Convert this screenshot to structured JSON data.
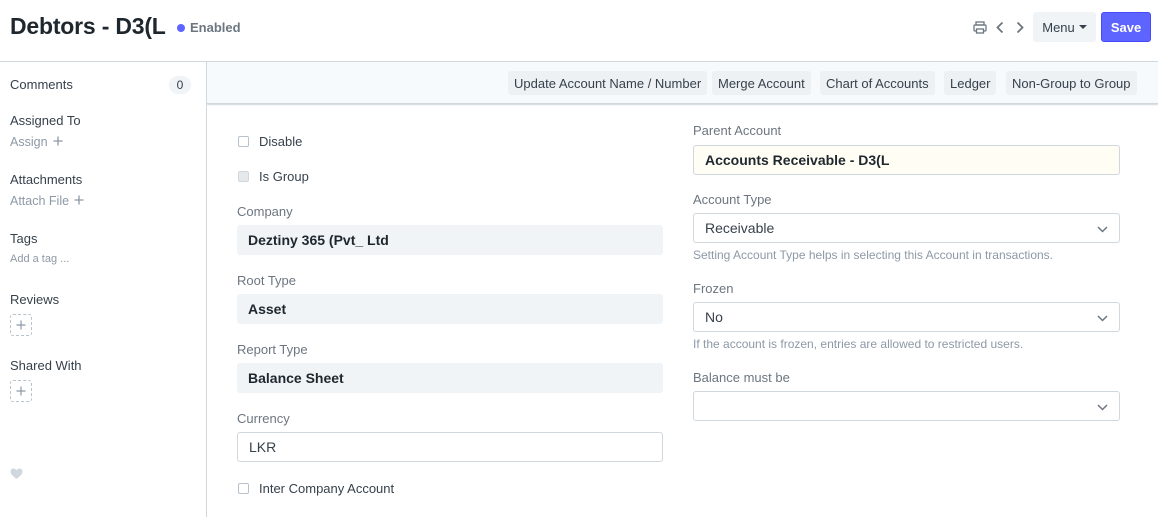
{
  "header": {
    "title": "Debtors - D3(L",
    "status": "Enabled",
    "menu_label": "Menu",
    "save_label": "Save"
  },
  "sidebar": {
    "comments_label": "Comments",
    "comments_count": "0",
    "assigned_label": "Assigned To",
    "assign_action": "Assign",
    "attachments_label": "Attachments",
    "attach_action": "Attach File",
    "tags_label": "Tags",
    "tag_action": "Add a tag ...",
    "reviews_label": "Reviews",
    "shared_label": "Shared With"
  },
  "toolbar": {
    "buttons": [
      "Update Account Name / Number",
      "Merge Account",
      "Chart of Accounts",
      "Ledger",
      "Non-Group to Group"
    ]
  },
  "form": {
    "disable_label": "Disable",
    "is_group_label": "Is Group",
    "company_label": "Company",
    "company_value": "Deztiny 365 (Pvt_ Ltd",
    "root_type_label": "Root Type",
    "root_type_value": "Asset",
    "report_type_label": "Report Type",
    "report_type_value": "Balance Sheet",
    "currency_label": "Currency",
    "currency_value": "LKR",
    "inter_company_label": "Inter Company Account",
    "parent_account_label": "Parent Account",
    "parent_account_value": "Accounts Receivable - D3(L",
    "account_type_label": "Account Type",
    "account_type_value": "Receivable",
    "account_type_help": "Setting Account Type helps in selecting this Account in transactions.",
    "frozen_label": "Frozen",
    "frozen_value": "No",
    "frozen_help": "If the account is frozen, entries are allowed to restricted users.",
    "balance_label": "Balance must be",
    "balance_value": ""
  },
  "colors": {
    "primary": "#5e64ff",
    "status_dot": "#5e64ff"
  }
}
